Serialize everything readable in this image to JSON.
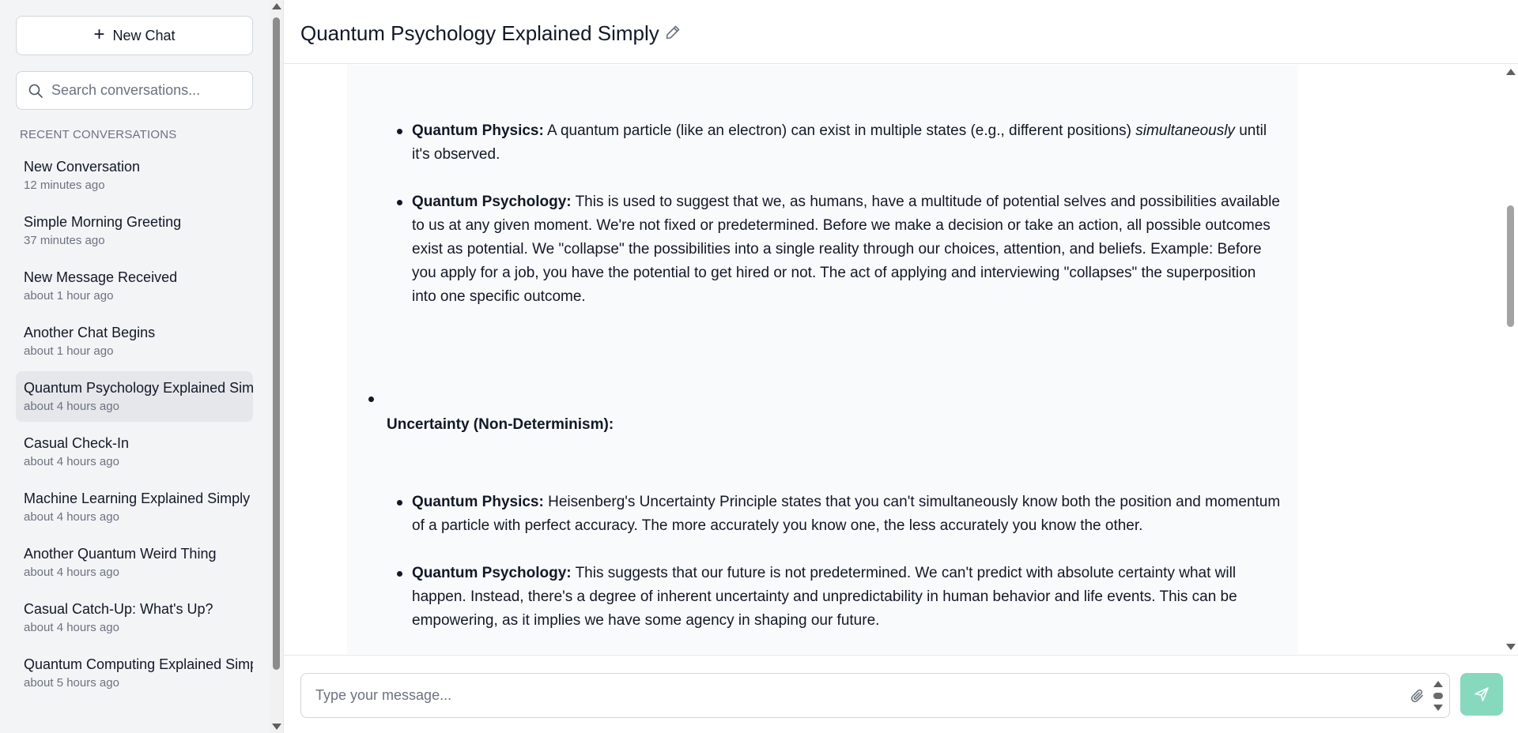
{
  "sidebar": {
    "new_chat_label": "New Chat",
    "search_placeholder": "Search conversations...",
    "section_title": "RECENT CONVERSATIONS",
    "conversations": [
      {
        "title": "New Conversation",
        "time": "12 minutes ago"
      },
      {
        "title": "Simple Morning Greeting",
        "time": "37 minutes ago"
      },
      {
        "title": "New Message Received",
        "time": "about 1 hour ago"
      },
      {
        "title": "Another Chat Begins",
        "time": "about 1 hour ago"
      },
      {
        "title": "Quantum Psychology Explained Simply",
        "time": "about 4 hours ago",
        "active": true
      },
      {
        "title": "Casual Check-In",
        "time": "about 4 hours ago"
      },
      {
        "title": "Machine Learning Explained Simply",
        "time": "about 4 hours ago"
      },
      {
        "title": "Another Quantum Weird Thing",
        "time": "about 4 hours ago"
      },
      {
        "title": "Casual Catch-Up: What's Up?",
        "time": "about 4 hours ago"
      },
      {
        "title": "Quantum Computing Explained Simply",
        "time": "about 5 hours ago"
      }
    ]
  },
  "header": {
    "title": "Quantum Psychology Explained Simply"
  },
  "message": {
    "b1_label": "Quantum Physics:",
    "b1_text_a": " A quantum particle (like an electron) can exist in multiple states (e.g., different positions) ",
    "b1_italic": "simultaneously",
    "b1_text_b": " until it's observed.",
    "b2_label": "Quantum Psychology:",
    "b2_text": "  This is used to suggest that we, as humans, have a multitude of potential selves and possibilities available to us at any given moment. We're not fixed or predetermined.  Before we make a decision or take an action, all possible outcomes exist as potential. We \"collapse\" the possibilities into a single reality through our choices, attention, and beliefs.  Example: Before you apply for a job, you have the potential to get hired or not. The act of applying and interviewing \"collapses\" the superposition into one specific outcome.",
    "heading2": "Uncertainty (Non-Determinism):",
    "b3_label": "Quantum Physics:",
    "b3_text": " Heisenberg's Uncertainty Principle states that you can't simultaneously know both the position and momentum of a particle with perfect accuracy.  The more accurately you know one, the less accurately you know the other.",
    "b4_label": "Quantum Psychology:",
    "b4_text": " This suggests that our future is not predetermined.  We can't predict with absolute certainty what will happen.  Instead, there's a degree of inherent uncertainty and unpredictability in human behavior and life events. This can be empowering, as it implies we have some agency in shaping our future."
  },
  "input": {
    "placeholder": "Type your message..."
  },
  "colors": {
    "send_button": "#86d9bc",
    "active_item": "#e5e7eb",
    "sidebar_bg": "#f3f4f6"
  }
}
